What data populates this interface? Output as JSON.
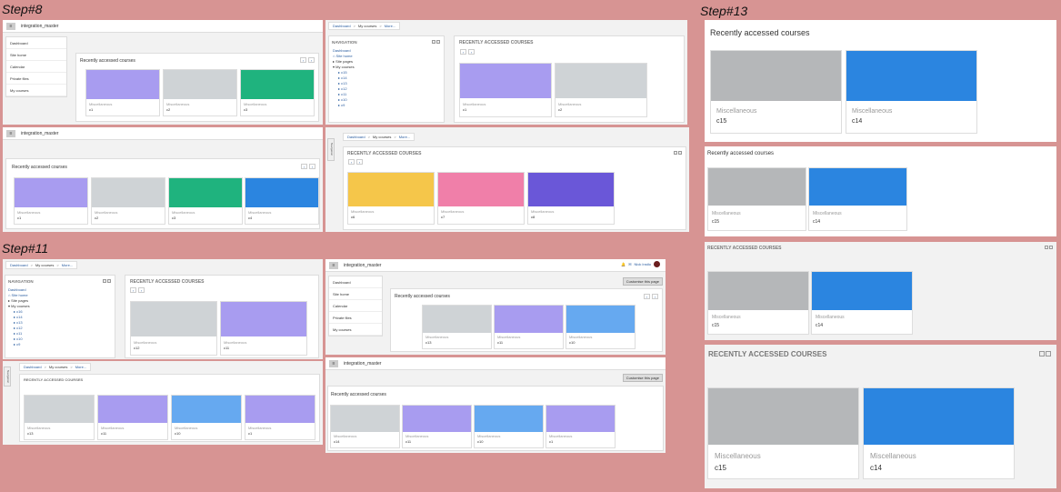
{
  "steps": {
    "s8": "Step#8",
    "s11": "Step#11",
    "s13": "Step#13"
  },
  "app": {
    "site_name": "integration_master",
    "customise_label": "Customise this page",
    "user_name": "Nick Instlo"
  },
  "menu": [
    "Dashboard",
    "Site home",
    "Calendar",
    "Private files",
    "My courses"
  ],
  "nav": {
    "heading": "NAVIGATION",
    "tab": "Navigation",
    "dashboard": "Dashboard",
    "site_home": "Site home",
    "site_pages": "Site pages",
    "my_courses": "My courses",
    "courses_a": [
      "c15",
      "c14",
      "c13",
      "c12",
      "c11",
      "c10",
      "c9"
    ],
    "courses_b": [
      "c16",
      "c14",
      "c13",
      "c12",
      "c11",
      "c10",
      "c9"
    ]
  },
  "crumbs": [
    "Dashboard",
    "My courses",
    "More..."
  ],
  "block": {
    "title": "Recently accessed courses",
    "title_caps": "RECENTLY ACCESSED COURSES"
  },
  "category": "Miscellaneous",
  "courses": {
    "p1": [
      "c1",
      "c2",
      "c3"
    ],
    "p2": [
      "c1",
      "c2",
      "c3",
      "c4"
    ],
    "p3": [
      "c1",
      "c2"
    ],
    "p4": [
      "c6",
      "c7",
      "c8"
    ],
    "p5": [
      "c12",
      "c11"
    ],
    "p6": [
      "c13",
      "c11",
      "c10"
    ],
    "p7": [
      "c13",
      "c11",
      "c10",
      "c1"
    ],
    "p8": [
      "c14",
      "c11",
      "c10",
      "c1"
    ],
    "right": [
      "c15",
      "c14"
    ]
  },
  "colors": {
    "purple": "#a89cf0",
    "grey": "#cfd3d6",
    "green": "#1fb37e",
    "blue": "#2b85e0",
    "yellow": "#f5c64a",
    "pink": "#f07fa9",
    "indigo": "#6a57d8",
    "lightblue": "#66a9f0",
    "darkgrey": "#b5b7b9",
    "link": "#2a5da0"
  }
}
